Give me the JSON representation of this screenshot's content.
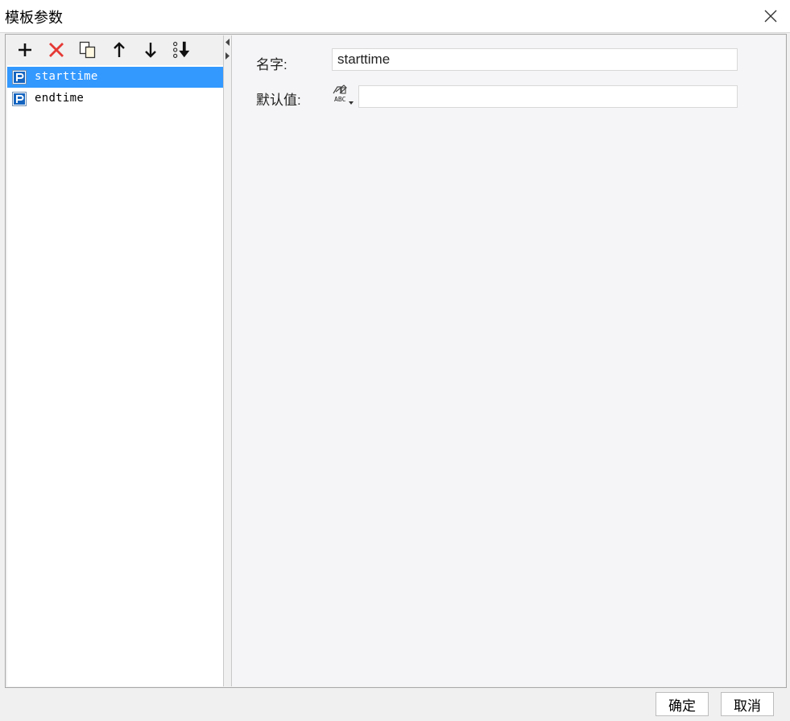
{
  "window": {
    "title": "模板参数"
  },
  "toolbar": {
    "icons": [
      "add-icon",
      "delete-icon",
      "copy-icon",
      "move-up-icon",
      "move-down-icon",
      "sort-icon"
    ]
  },
  "parameters": {
    "items": [
      {
        "label": "starttime",
        "selected": true
      },
      {
        "label": "endtime",
        "selected": false
      }
    ]
  },
  "form": {
    "name_label": "名字:",
    "name_value": "starttime",
    "default_label": "默认值:",
    "default_value": "",
    "type_icon": "abc-type-icon"
  },
  "footer": {
    "ok_label": "确定",
    "cancel_label": "取消"
  },
  "colors": {
    "selection": "#3399ff",
    "delete": "#e53935",
    "param_icon": "#1565c0"
  }
}
